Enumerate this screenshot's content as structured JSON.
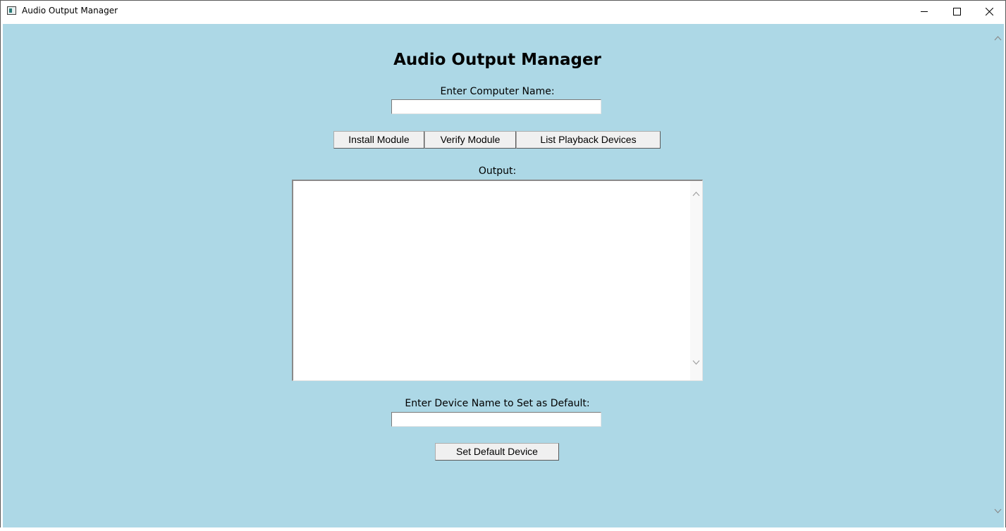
{
  "window": {
    "title": "Audio Output Manager"
  },
  "app": {
    "heading": "Audio Output Manager",
    "computer_name_label": "Enter Computer Name:",
    "computer_name_value": "",
    "buttons": {
      "install": "Install Module",
      "verify": "Verify Module",
      "list": "List Playback Devices",
      "set_default": "Set Default Device"
    },
    "output_label": "Output:",
    "output_text": "",
    "device_name_label": "Enter Device Name to Set as Default:",
    "device_name_value": ""
  },
  "icons": {
    "app": "app-window-icon",
    "minimize": "minimize-icon",
    "maximize": "maximize-icon",
    "close": "close-icon",
    "scroll_up": "chevron-up-icon",
    "scroll_down": "chevron-down-icon"
  },
  "colors": {
    "client_background": "#add8e6",
    "button_face": "#f0f0f0",
    "titlebar": "#ffffff"
  }
}
